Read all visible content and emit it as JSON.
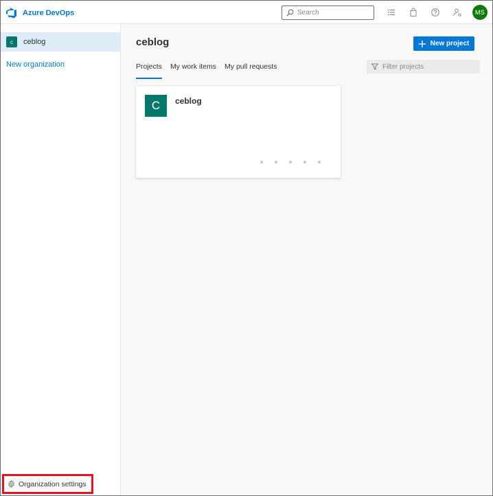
{
  "topbar": {
    "brand_name": "Azure DevOps",
    "search_placeholder": "Search",
    "avatar_initials": "MS",
    "icons": [
      "work-items-icon",
      "marketplace-icon",
      "help-icon",
      "user-settings-icon"
    ]
  },
  "sidebar": {
    "organization": {
      "badge": "c",
      "name": "ceblog"
    },
    "new_organization_label": "New organization",
    "organization_settings_label": "Organization settings"
  },
  "main": {
    "title": "ceblog",
    "new_project_label": "New project",
    "tabs": [
      {
        "label": "Projects",
        "active": true
      },
      {
        "label": "My work items",
        "active": false
      },
      {
        "label": "My pull requests",
        "active": false
      }
    ],
    "filter_placeholder": "Filter projects",
    "project_card": {
      "badge": "C",
      "name": "ceblog"
    }
  },
  "colors": {
    "accent": "#0078d4",
    "project_badge": "#00796b",
    "avatar": "#0f7b0f",
    "highlight_box": "#e81123",
    "selected_org_bg": "#deecf9"
  }
}
